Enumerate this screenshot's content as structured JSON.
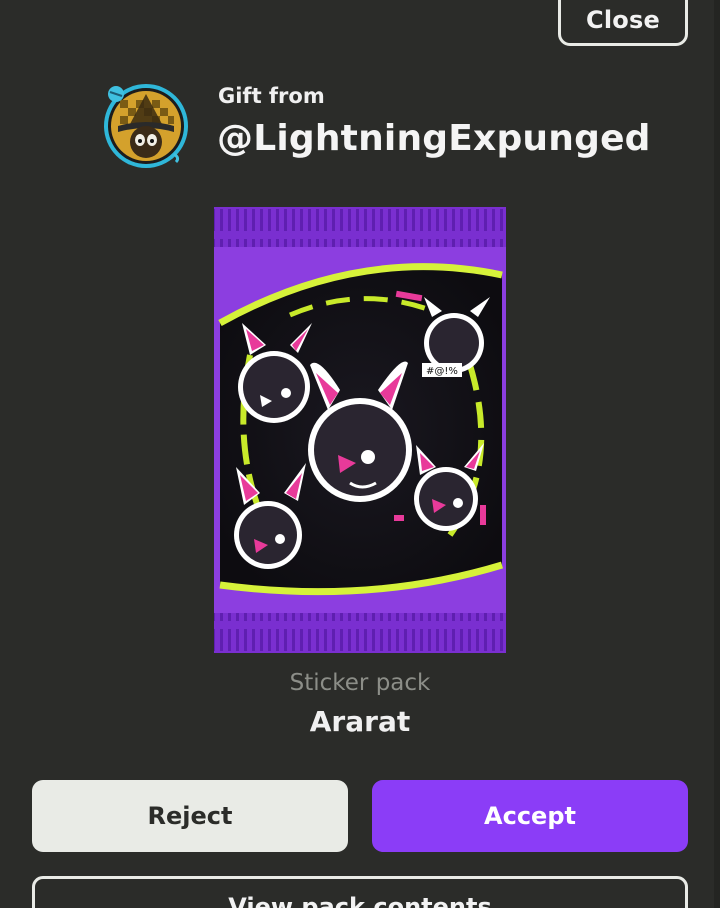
{
  "header": {
    "close_label": "Close"
  },
  "sender": {
    "gift_label": "Gift from",
    "username": "@LightningExpunged",
    "avatar_icon": "avatar-icon"
  },
  "pack": {
    "type_label": "Sticker pack",
    "name": "Ararat",
    "image_icon": "sticker-pack-icon"
  },
  "actions": {
    "reject_label": "Reject",
    "accept_label": "Accept",
    "view_label": "View pack contents"
  },
  "colors": {
    "background": "#2b2c29",
    "accent": "#8b3df7",
    "light_button": "#e9ebe6",
    "muted_text": "#8c8e88"
  }
}
